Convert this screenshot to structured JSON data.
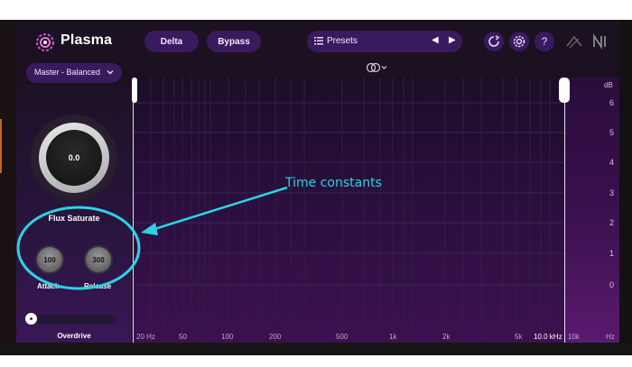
{
  "header": {
    "app_name": "Plasma",
    "delta_label": "Delta",
    "bypass_label": "Bypass",
    "presets_label": "Presets",
    "help_glyph": "?",
    "icons": [
      "plasma-logo-icon",
      "list-icon",
      "prev-arrow-icon",
      "next-arrow-icon",
      "loop-icon",
      "gear-icon",
      "help-icon",
      "signal-icon",
      "ni-logo-icon"
    ]
  },
  "master": {
    "label": "Master - Balanced"
  },
  "controls": {
    "flux_value": "0.0",
    "flux_label": "Flux Saturate",
    "attack_value": "100",
    "attack_label": "Attack",
    "release_value": "300",
    "release_label": "Release",
    "overdrive_label": "Overdrive",
    "overdrive_level": 0
  },
  "graph": {
    "db_unit": "dB",
    "db_ticks": [
      "6",
      "5",
      "4",
      "3",
      "2",
      "1",
      "0"
    ],
    "freq_unit": "Hz",
    "freq_labels": [
      "20 Hz",
      "50",
      "100",
      "200",
      "500",
      "1k",
      "2k",
      "5k",
      "10.0 kHz",
      "10k"
    ]
  },
  "annotation": {
    "text": "Time constants",
    "color": "#2ad4e4"
  },
  "colors": {
    "accent": "#3a1a5e",
    "annotation": "#2ad4e4",
    "background": "#1a1020"
  }
}
